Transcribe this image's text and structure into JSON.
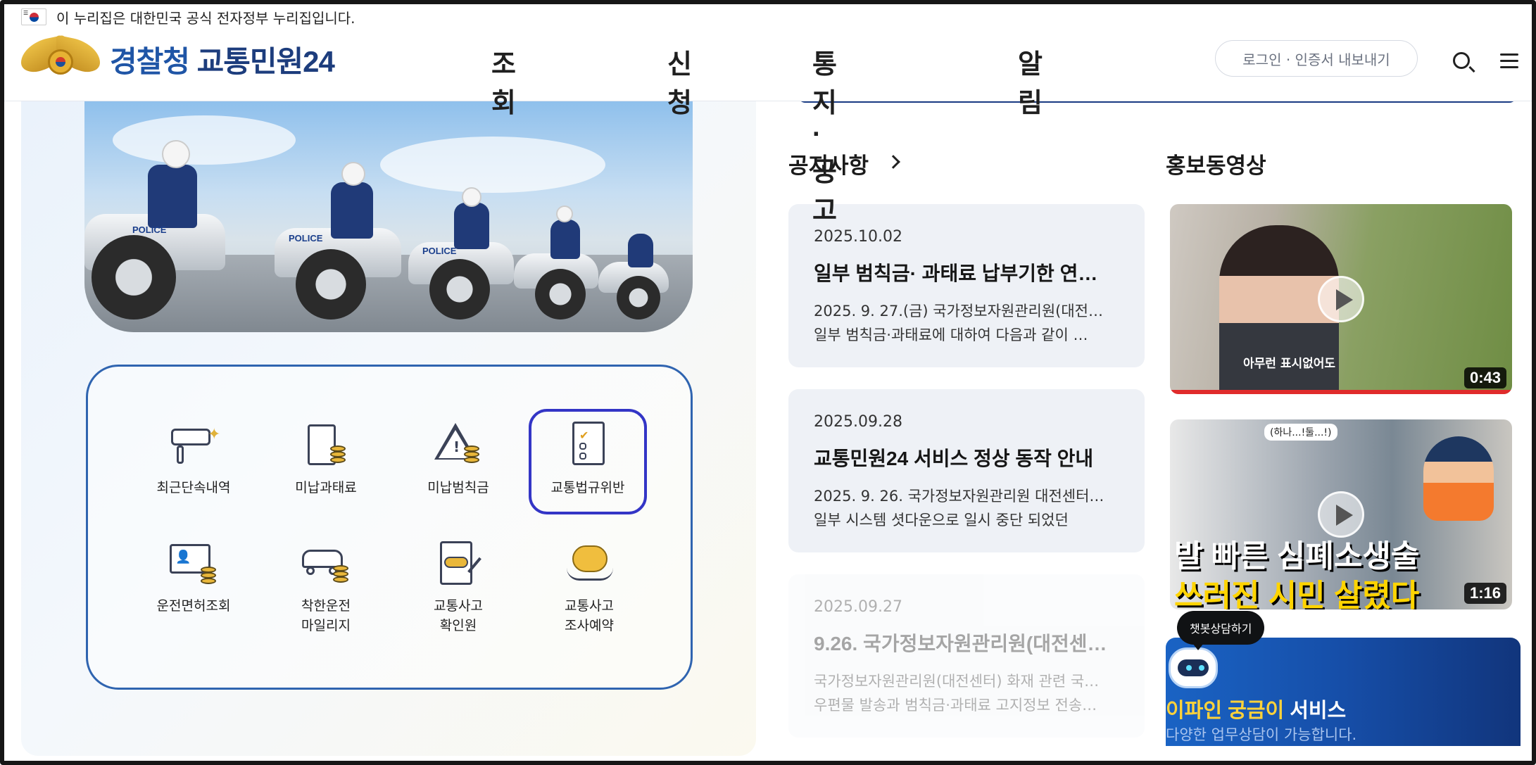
{
  "gov_banner": {
    "text": "이 누리집은 대한민국 공식 전자정부 누리집입니다."
  },
  "header": {
    "logo_part1": "경찰청",
    "logo_part2": "교통민원24",
    "nav": [
      {
        "label": "조회"
      },
      {
        "label": "신청"
      },
      {
        "label": "통지·공고"
      },
      {
        "label": "알림"
      }
    ],
    "login_label": "로그인 · 인증서 내보내기"
  },
  "hero": {
    "bike_labels": [
      "POLICE",
      "POLICE",
      "POLICE"
    ]
  },
  "services": [
    {
      "label": "최근단속내역",
      "icon": "camera-icon"
    },
    {
      "label": "미납과태료",
      "icon": "receipt-coins-icon"
    },
    {
      "label": "미납범칙금",
      "icon": "warning-coins-icon"
    },
    {
      "label": "교통법규위반",
      "icon": "checklist-icon",
      "selected": true
    },
    {
      "label": "운전면허조회",
      "icon": "license-coins-icon"
    },
    {
      "label": "착한운전\n마일리지",
      "icon": "car-coins-icon"
    },
    {
      "label": "교통사고\n확인원",
      "icon": "accident-document-icon"
    },
    {
      "label": "교통사고\n조사예약",
      "icon": "piggy-bank-icon"
    }
  ],
  "notices": {
    "title": "공지사항",
    "items": [
      {
        "date": "2025.10.02",
        "title": "일부 범칙금· 과태료 납부기한 연…",
        "line1": "2025. 9. 27.(금) 국가정보자원관리원(대전…",
        "line2": "일부 범칙금·과태료에 대하여 다음과 같이 …"
      },
      {
        "date": "2025.09.28",
        "title": "교통민원24 서비스 정상 동작 안내",
        "line1": "2025. 9. 26. 국가정보자원관리원 대전센터…",
        "line2": "일부 시스템 셧다운으로 일시 중단 되었던"
      },
      {
        "date": "2025.09.27",
        "title": "9.26. 국가정보자원관리원(대전센…",
        "line1": "국가정보자원관리원(대전센터) 화재 관련 국…",
        "line2": "우편물 발송과 범칙금·과태료 고지정보 전송…"
      }
    ]
  },
  "videos": {
    "title": "홍보동영상",
    "items": [
      {
        "duration": "0:43",
        "caption": "아무런 표시없어도"
      },
      {
        "duration": "1:16",
        "bubble": "(하나...!둘...!)",
        "headline1": "발 빠른 심폐소생술",
        "headline2": "쓰러진 시민 살렸다"
      }
    ]
  },
  "chatbot": {
    "tooltip": "챗봇상담하기",
    "title_highlight": "이파인 궁금이",
    "title_rest": " 서비스",
    "subtitle": "다양한 업무상담이 가능합니다."
  },
  "colors": {
    "brand_blue": "#1f55a6",
    "selected_border": "#3335c6",
    "panel_border": "#2f64b0",
    "chatbot_highlight": "#ffd23a"
  }
}
